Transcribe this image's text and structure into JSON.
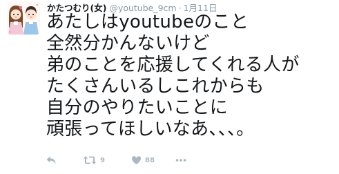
{
  "tweet": {
    "display_name": "かたつむり(女)",
    "handle": "@youtube_9cm",
    "separator": "·",
    "timestamp": "1月11日",
    "lines": [
      "あたしはyoutubeのこと",
      "全然分かんないけど",
      "弟のことを応援してくれる人が",
      "たくさんいるしこれからも",
      "自分のやりたいことに",
      "頑張ってほしいなあ、、、。"
    ],
    "actions": {
      "reply_icon": "reply-icon",
      "retweet_icon": "retweet-icon",
      "retweet_count": "9",
      "like_icon": "heart-icon",
      "like_count": "88",
      "more_icon": "more-icon"
    }
  },
  "colors": {
    "text": "#14171a",
    "muted": "#8899a6",
    "action_icon": "#aab8c2"
  }
}
